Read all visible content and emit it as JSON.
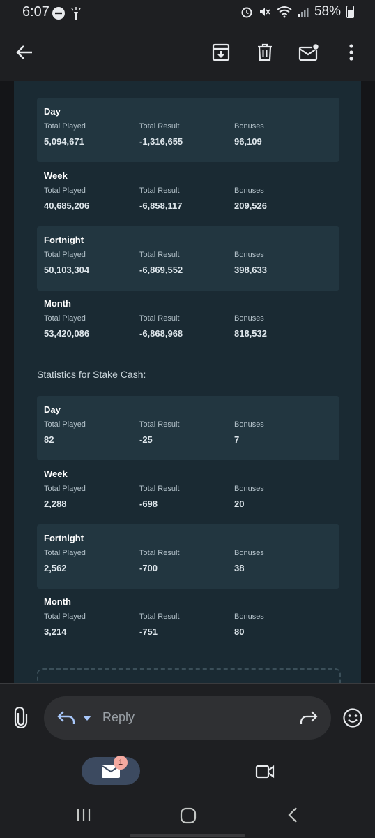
{
  "status": {
    "time": "6:07",
    "battery": "58%"
  },
  "toolbar": {
    "back": "back",
    "archive": "archive",
    "delete": "delete",
    "mark_unread": "mark unread",
    "more": "more"
  },
  "stats_top": [
    {
      "period": "Day",
      "total_played": "5,094,671",
      "total_result": "-1,316,655",
      "bonuses": "96,109"
    },
    {
      "period": "Week",
      "total_played": "40,685,206",
      "total_result": "-6,858,117",
      "bonuses": "209,526"
    },
    {
      "period": "Fortnight",
      "total_played": "50,103,304",
      "total_result": "-6,869,552",
      "bonuses": "398,633"
    },
    {
      "period": "Month",
      "total_played": "53,420,086",
      "total_result": "-6,868,968",
      "bonuses": "818,532"
    }
  ],
  "stake_cash_title": "Statistics for Stake Cash:",
  "stats_stake_cash": [
    {
      "period": "Day",
      "total_played": "82",
      "total_result": "-25",
      "bonuses": "7"
    },
    {
      "period": "Week",
      "total_played": "2,288",
      "total_result": "-698",
      "bonuses": "20"
    },
    {
      "period": "Fortnight",
      "total_played": "2,562",
      "total_result": "-700",
      "bonuses": "38"
    },
    {
      "period": "Month",
      "total_played": "3,214",
      "total_result": "-751",
      "bonuses": "80"
    }
  ],
  "labels": {
    "total_played": "Total Played",
    "total_result": "Total Result",
    "bonuses": "Bonuses"
  },
  "reply": {
    "placeholder": "Reply"
  },
  "nav": {
    "mail_badge": "1"
  }
}
